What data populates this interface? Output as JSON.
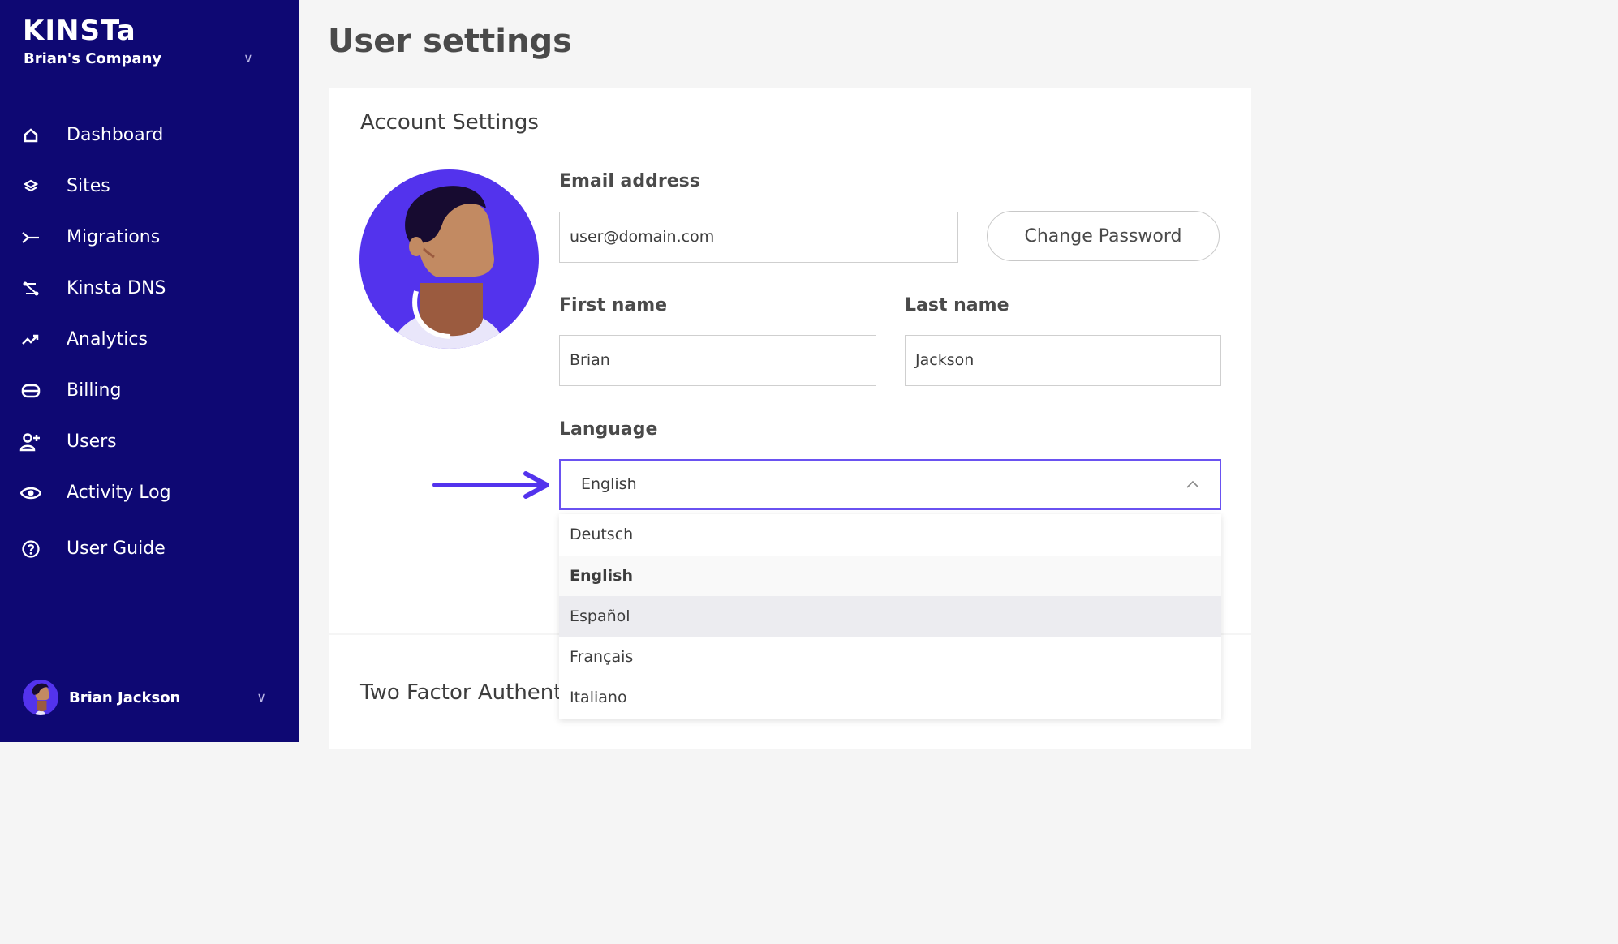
{
  "sidebar": {
    "brand": "KINSTa",
    "company": "Brian's Company",
    "items": [
      {
        "label": "Dashboard",
        "icon": "home-icon"
      },
      {
        "label": "Sites",
        "icon": "layers-icon"
      },
      {
        "label": "Migrations",
        "icon": "migrate-icon"
      },
      {
        "label": "Kinsta DNS",
        "icon": "dns-icon"
      },
      {
        "label": "Analytics",
        "icon": "trend-icon"
      },
      {
        "label": "Billing",
        "icon": "billing-icon"
      },
      {
        "label": "Users",
        "icon": "add-user-icon"
      },
      {
        "label": "Activity Log",
        "icon": "eye-icon"
      },
      {
        "label": "User Guide",
        "icon": "help-icon"
      }
    ],
    "user_name": "Brian Jackson"
  },
  "page": {
    "title": "User settings"
  },
  "account": {
    "title": "Account Settings",
    "email_label": "Email address",
    "email_value": "user@domain.com",
    "change_password": "Change Password",
    "first_name_label": "First name",
    "first_name_value": "Brian",
    "last_name_label": "Last name",
    "last_name_value": "Jackson",
    "language_label": "Language",
    "language_value": "English",
    "language_options": [
      "Deutsch",
      "English",
      "Español",
      "Français",
      "Italiano"
    ]
  },
  "two_factor": {
    "title": "Two Factor Authenti"
  },
  "colors": {
    "sidebar": "#0e0873",
    "accent": "#5333ed",
    "avatar_bg": "#5333ed"
  }
}
